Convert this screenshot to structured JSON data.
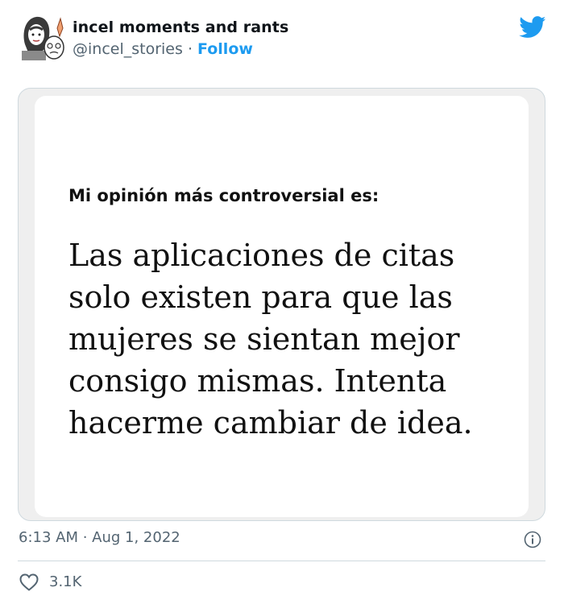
{
  "tweet": {
    "author_name": "incel moments and rants",
    "author_handle": "@incel_stories",
    "separator": "·",
    "follow_label": "Follow",
    "timestamp": "6:13 AM · Aug 1, 2022",
    "likes": "3.1K"
  },
  "media": {
    "heading": "Mi opinión más controversial es:",
    "body": "Las aplicaciones de citas solo existen para que las mujeres se sientan mejor consigo mismas. Intenta hacerme cambiar de idea."
  },
  "icons": {
    "logo": "twitter-bird-icon",
    "info": "info-icon",
    "like": "heart-icon",
    "avatar": "avatar"
  },
  "colors": {
    "accent": "#1d9bf0",
    "secondary_text": "#536471",
    "border": "#cfd9de"
  }
}
